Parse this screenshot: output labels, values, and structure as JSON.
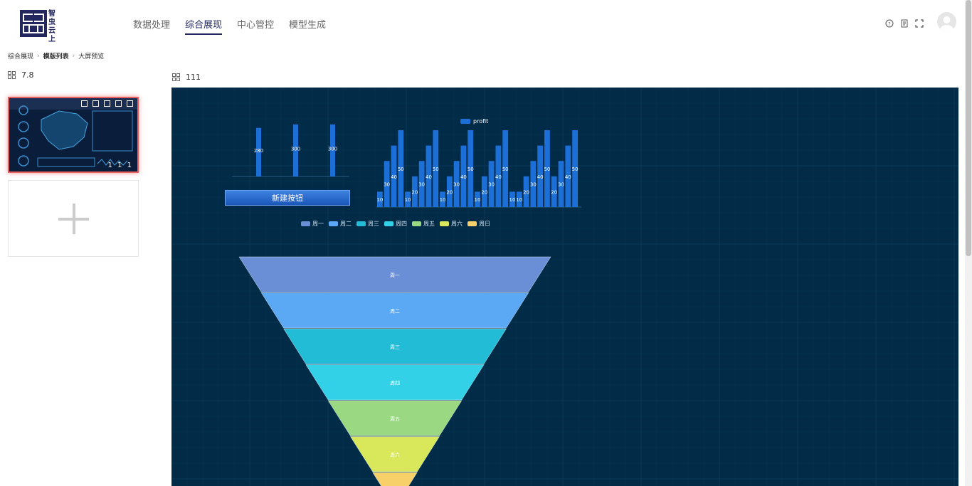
{
  "app": {
    "logo_text": "智虫云上"
  },
  "nav": {
    "items": [
      {
        "label": "数据处理"
      },
      {
        "label": "综合展现"
      },
      {
        "label": "中心管控"
      },
      {
        "label": "模型生成"
      }
    ],
    "active_index": 1
  },
  "header_icons": [
    "help-icon",
    "document-icon",
    "fullscreen-icon"
  ],
  "breadcrumb": [
    "综合展现",
    "模版列表",
    "大屏预览"
  ],
  "left_panel": {
    "title": "7.8",
    "thumbnail_label": "1 1 1",
    "thumbnail_toolbar_icons": [
      "share-icon",
      "copy-icon",
      "preview-icon",
      "delete-icon",
      "edit-icon"
    ]
  },
  "main_panel": {
    "title": "111"
  },
  "canvas": {
    "new_button_label": "新建按钮",
    "bg_color": "#012b47",
    "funnel_legend": [
      {
        "label": "周一",
        "color": "#6b8fd6"
      },
      {
        "label": "周二",
        "color": "#5ba8f5"
      },
      {
        "label": "周三",
        "color": "#22bcd6"
      },
      {
        "label": "周四",
        "color": "#33d1e8"
      },
      {
        "label": "周五",
        "color": "#9ad982"
      },
      {
        "label": "周六",
        "color": "#d9e85a"
      },
      {
        "label": "周日",
        "color": "#f7d06a"
      }
    ]
  },
  "chart_data": [
    {
      "type": "bar",
      "categories": [
        "",
        "",
        ""
      ],
      "values": [
        280,
        300,
        300
      ],
      "data_labels": [
        "280",
        "300",
        "300"
      ],
      "bar_color": "#1c6fd6",
      "ylim": [
        0,
        320
      ]
    },
    {
      "type": "bar",
      "legend": [
        "profit"
      ],
      "values": [
        10,
        30,
        40,
        50,
        10,
        20,
        30,
        40,
        50,
        10,
        20,
        30,
        40,
        50,
        10,
        20,
        30,
        40,
        50,
        10,
        10,
        20,
        30,
        40,
        50,
        20,
        30,
        40,
        50
      ],
      "data_labels": [
        "10",
        "30",
        "40",
        "50",
        "10",
        "20",
        "30",
        "40",
        "50",
        "10",
        "20",
        "30",
        "40",
        "50",
        "10",
        "20",
        "30",
        "40",
        "50",
        "10",
        "10",
        "20",
        "30",
        "40",
        "50",
        "20",
        "30",
        "40",
        "50"
      ],
      "bar_color": "#1c6fd6",
      "ylim": [
        0,
        50
      ]
    },
    {
      "type": "funnel",
      "categories": [
        "周一",
        "周二",
        "周三",
        "周四",
        "周五",
        "周六",
        "周日"
      ],
      "values": [
        7,
        6,
        5,
        4,
        3,
        2,
        1
      ],
      "labels": [
        "周一",
        "周二",
        "周三",
        "周四",
        "周五",
        "周六"
      ]
    }
  ]
}
